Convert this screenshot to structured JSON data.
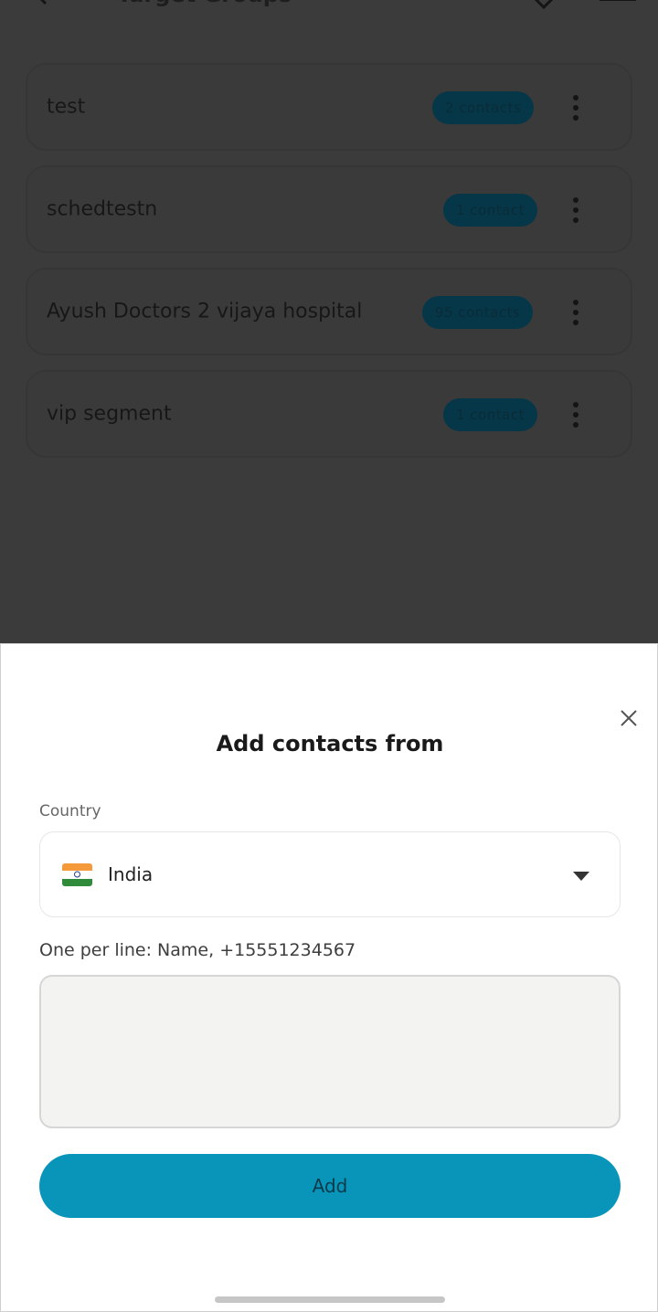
{
  "header": {
    "title": "Target Groups",
    "back_icon": "chevron-left-icon",
    "favorite_icon": "heart-icon",
    "menu_icon": "hamburger-menu-icon"
  },
  "groups": [
    {
      "name": "test",
      "count": "2 contacts"
    },
    {
      "name": "schedtestn",
      "count": "1 contact"
    },
    {
      "name": "Ayush Doctors 2 vijaya hospital",
      "count": "95 contacts"
    },
    {
      "name": "vip segment",
      "count": "1 contact"
    }
  ],
  "sheet": {
    "title": "Add contacts from",
    "country_label": "Country",
    "country_value": "India",
    "country_flag": "india-flag-icon",
    "helper_label": "One per line: Name, +15551234567",
    "textarea_value": "",
    "add_label": "Add",
    "colors": {
      "accent": "#0895b9",
      "overlay": "#3b3b3b"
    }
  }
}
